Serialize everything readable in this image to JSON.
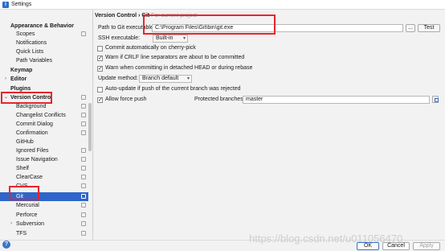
{
  "window": {
    "title": "Settings"
  },
  "sidebar": {
    "items": [
      {
        "label": "Appearance & Behavior",
        "bold": true
      },
      {
        "label": "Scopes"
      },
      {
        "label": "Notifications"
      },
      {
        "label": "Quick Lists"
      },
      {
        "label": "Path Variables"
      },
      {
        "label": "Keymap",
        "bold": true
      },
      {
        "label": "Editor",
        "bold": true
      },
      {
        "label": "Plugins",
        "bold": true
      },
      {
        "label": "Version Control",
        "bold": true
      },
      {
        "label": "Background"
      },
      {
        "label": "Changelist Conflicts"
      },
      {
        "label": "Commit Dialog"
      },
      {
        "label": "Confirmation"
      },
      {
        "label": "GitHub"
      },
      {
        "label": "Ignored Files"
      },
      {
        "label": "Issue Navigation"
      },
      {
        "label": "Shelf"
      },
      {
        "label": "ClearCase"
      },
      {
        "label": "CVS"
      },
      {
        "label": "Git"
      },
      {
        "label": "Mercurial"
      },
      {
        "label": "Perforce"
      },
      {
        "label": "Subversion"
      },
      {
        "label": "TFS"
      }
    ],
    "selected": "Git"
  },
  "breadcrumb": {
    "section": "Version Control",
    "sep": "›",
    "page": "Git",
    "scope": "For current project"
  },
  "git": {
    "path_label": "Path to Git executable:",
    "path_value": "C:\\Program Files\\Git\\bin\\git.exe",
    "browse_label": "...",
    "test_label": "Test",
    "ssh_label": "SSH executable:",
    "ssh_value": "Built-in",
    "commit_cherry_label": "Commit automatically on cherry-pick",
    "warn_crlf_label": "Warn if CRLF line separators are about to be committed",
    "warn_detached_label": "Warn when committing in detached HEAD or during rebase",
    "update_method_label": "Update method:",
    "update_method_value": "Branch default",
    "auto_update_label": "Auto-update if push of the current branch was rejected",
    "allow_force_label": "Allow force push",
    "protected_label": "Protected branches:",
    "protected_value": "master"
  },
  "footer": {
    "ok": "OK",
    "cancel": "Cancel",
    "apply": "Apply"
  },
  "watermark": "https://blog.csdn.net/u011056470",
  "colors": {
    "selection": "#2f65ca",
    "highlight": "#e8262b"
  }
}
